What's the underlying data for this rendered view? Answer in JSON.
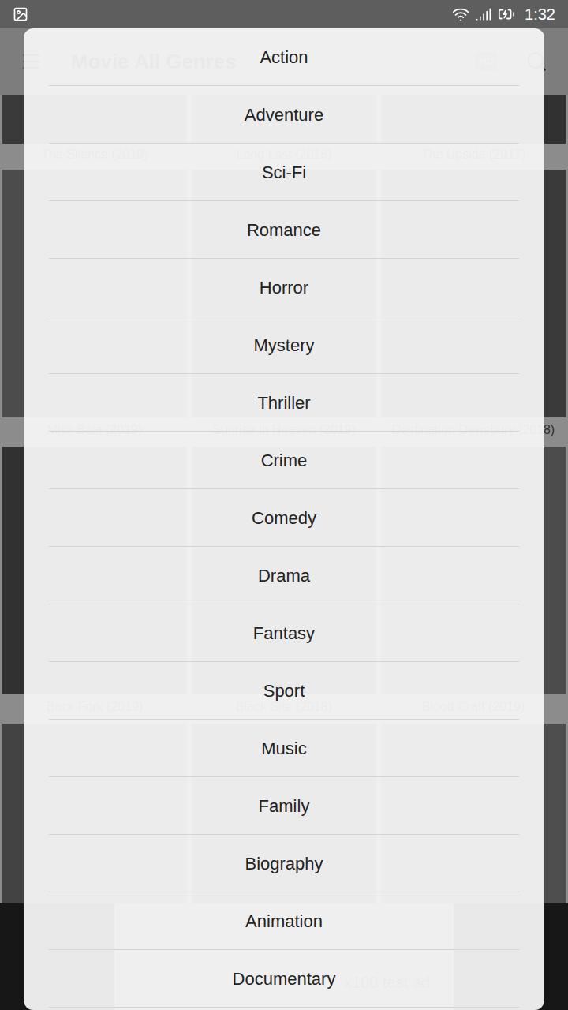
{
  "status_bar": {
    "time": "1:32"
  },
  "app_bar": {
    "title": "Movie All Genres",
    "badge": "HD"
  },
  "movie_rows": [
    [
      {
        "title": "The Silence (2019)"
      },
      {
        "title": "Long Lost (2018)"
      },
      {
        "title": "The Upside (2017)"
      }
    ],
    [
      {
        "title": "Miss Bala (2019)"
      },
      {
        "title": "Sunrise in Heaven (2019)"
      },
      {
        "title": "Destination Dewsbury (2018)"
      }
    ],
    [
      {
        "title": "Back Fork (2019)"
      },
      {
        "title": "Black Site (2018)"
      },
      {
        "title": "Blood Craft (2019)"
      }
    ]
  ],
  "ad": {
    "text": "x100 test ad"
  },
  "genre_dialog": {
    "items": [
      "Action",
      "Adventure",
      "Sci-Fi",
      "Romance",
      "Horror",
      "Mystery",
      "Thriller",
      "Crime",
      "Comedy",
      "Drama",
      "Fantasy",
      "Sport",
      "Music",
      "Family",
      "Biography",
      "Animation",
      "Documentary"
    ]
  }
}
